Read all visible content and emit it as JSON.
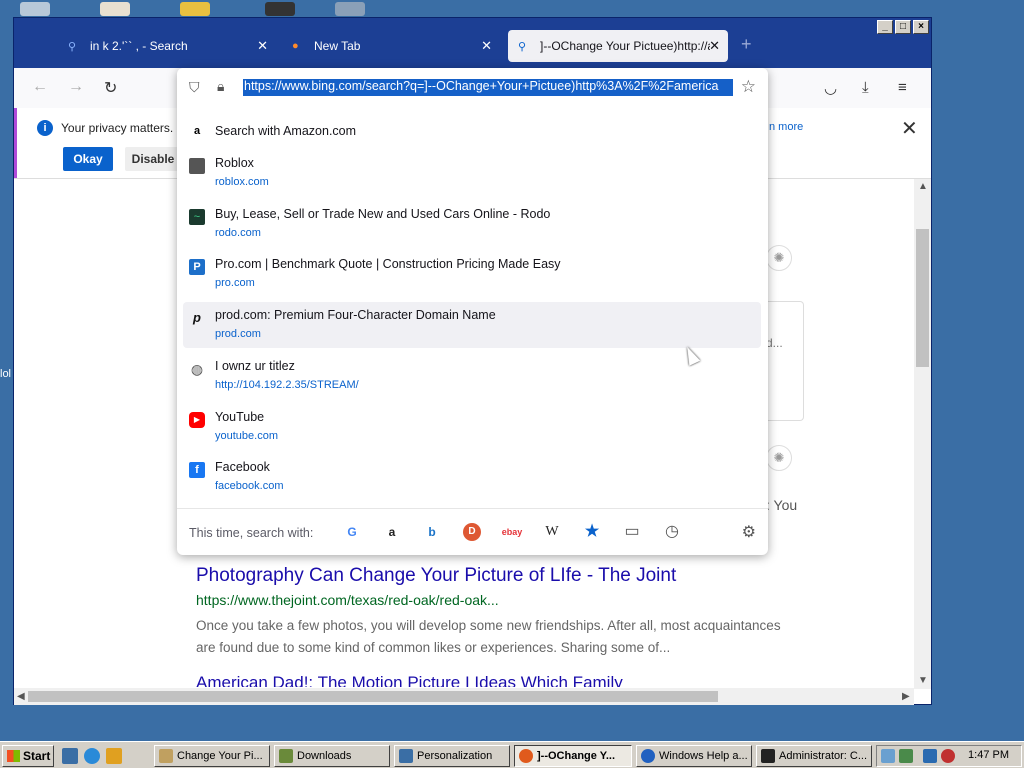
{
  "desktop": {
    "side_label": "lol"
  },
  "browser": {
    "tabs": [
      {
        "label": "in k 2.'`` , - Search",
        "icon": "search-icon"
      },
      {
        "label": "New Tab",
        "icon": "firefox-icon"
      },
      {
        "label": "]--OChange Your Pictuee)http://a",
        "icon": "search-icon",
        "active": true
      }
    ],
    "newtab_glyph": "+",
    "window_buttons": [
      "_",
      "□",
      "×"
    ],
    "privacy": {
      "text": "Your privacy matters. Fir",
      "okay_label": "Okay",
      "disable_label": "Disable",
      "learn_more": "n more"
    },
    "url": "https://www.bing.com/search?q=]--OChange+Your+Pictuee)http%3A%2F%2Famerica"
  },
  "dropdown": {
    "first": {
      "title": "Search with Amazon.com",
      "icon": "amazon-icon"
    },
    "items": [
      {
        "title": "Roblox",
        "url": "roblox.com",
        "icon": "roblox-icon",
        "color": "#555555"
      },
      {
        "title": "Buy, Lease, Sell or Trade New and Used Cars Online - Rodo",
        "url": "rodo.com",
        "icon": "rodo-icon",
        "color": "#1a7f5a"
      },
      {
        "title": "Pro.com | Benchmark Quote | Construction Pricing Made Easy",
        "url": "pro.com",
        "icon": "pro-icon",
        "color": "#1d6fc9"
      },
      {
        "title": "prod.com: Premium Four-Character Domain Name",
        "url": "prod.com",
        "icon": "prod-icon",
        "color": "#111111",
        "hover": true
      },
      {
        "title": "I ownz ur titlez",
        "url": "http://104.192.2.35/STREAM/",
        "icon": "globe-icon",
        "color": "#555555"
      },
      {
        "title": "YouTube",
        "url": "youtube.com",
        "icon": "youtube-icon",
        "color": "#ff0000"
      },
      {
        "title": "Facebook",
        "url": "facebook.com",
        "icon": "facebook-icon",
        "color": "#1877f2"
      }
    ],
    "search_with_label": "This time, search with:",
    "engines": [
      {
        "name": "google-icon",
        "glyph": "G",
        "color": "#4285f4"
      },
      {
        "name": "amazon-icon",
        "glyph": "a",
        "color": "#222222"
      },
      {
        "name": "bing-icon",
        "glyph": "b",
        "color": "#1a73c8"
      },
      {
        "name": "duckduckgo-icon",
        "glyph": "D",
        "color": "#de5833"
      },
      {
        "name": "ebay-icon",
        "glyph": "ebay",
        "color": "#e53238"
      },
      {
        "name": "wikipedia-icon",
        "glyph": "W",
        "color": "#222222"
      },
      {
        "name": "bookmarks-icon",
        "glyph": "★",
        "color": "#0a62cc"
      },
      {
        "name": "tabs-icon",
        "glyph": "▭",
        "color": "#555555"
      },
      {
        "name": "history-icon",
        "glyph": "◷",
        "color": "#555555"
      }
    ]
  },
  "results": {
    "title": "Photography Can Change Your Picture of LIfe - The Joint",
    "url": "https://www.thejoint.com/texas/red-oak/red-oak...",
    "snippet": "Once you take a few photos, you will develop some new friendships. After all, most acquaintances are found due to some kind of common likes or experiences. Sharing some of...",
    "next_title": "American Dad!: The Motion Picture I Ideas Which Family",
    "card_text": "d...",
    "partial_text": ": You"
  },
  "taskbar": {
    "start_label": "Start",
    "tasks": [
      {
        "label": "Change Your Pi...",
        "color": "#c0a060"
      },
      {
        "label": "Downloads",
        "color": "#6a8a3a"
      },
      {
        "label": "Personalization",
        "color": "#3a6ea5"
      },
      {
        "label": "]--OChange Y...",
        "color": "#e05a1c",
        "active": true
      },
      {
        "label": "Windows Help a...",
        "color": "#2060c0"
      },
      {
        "label": "Administrator: C...",
        "color": "#222222"
      }
    ],
    "clock": "1:47 PM"
  }
}
